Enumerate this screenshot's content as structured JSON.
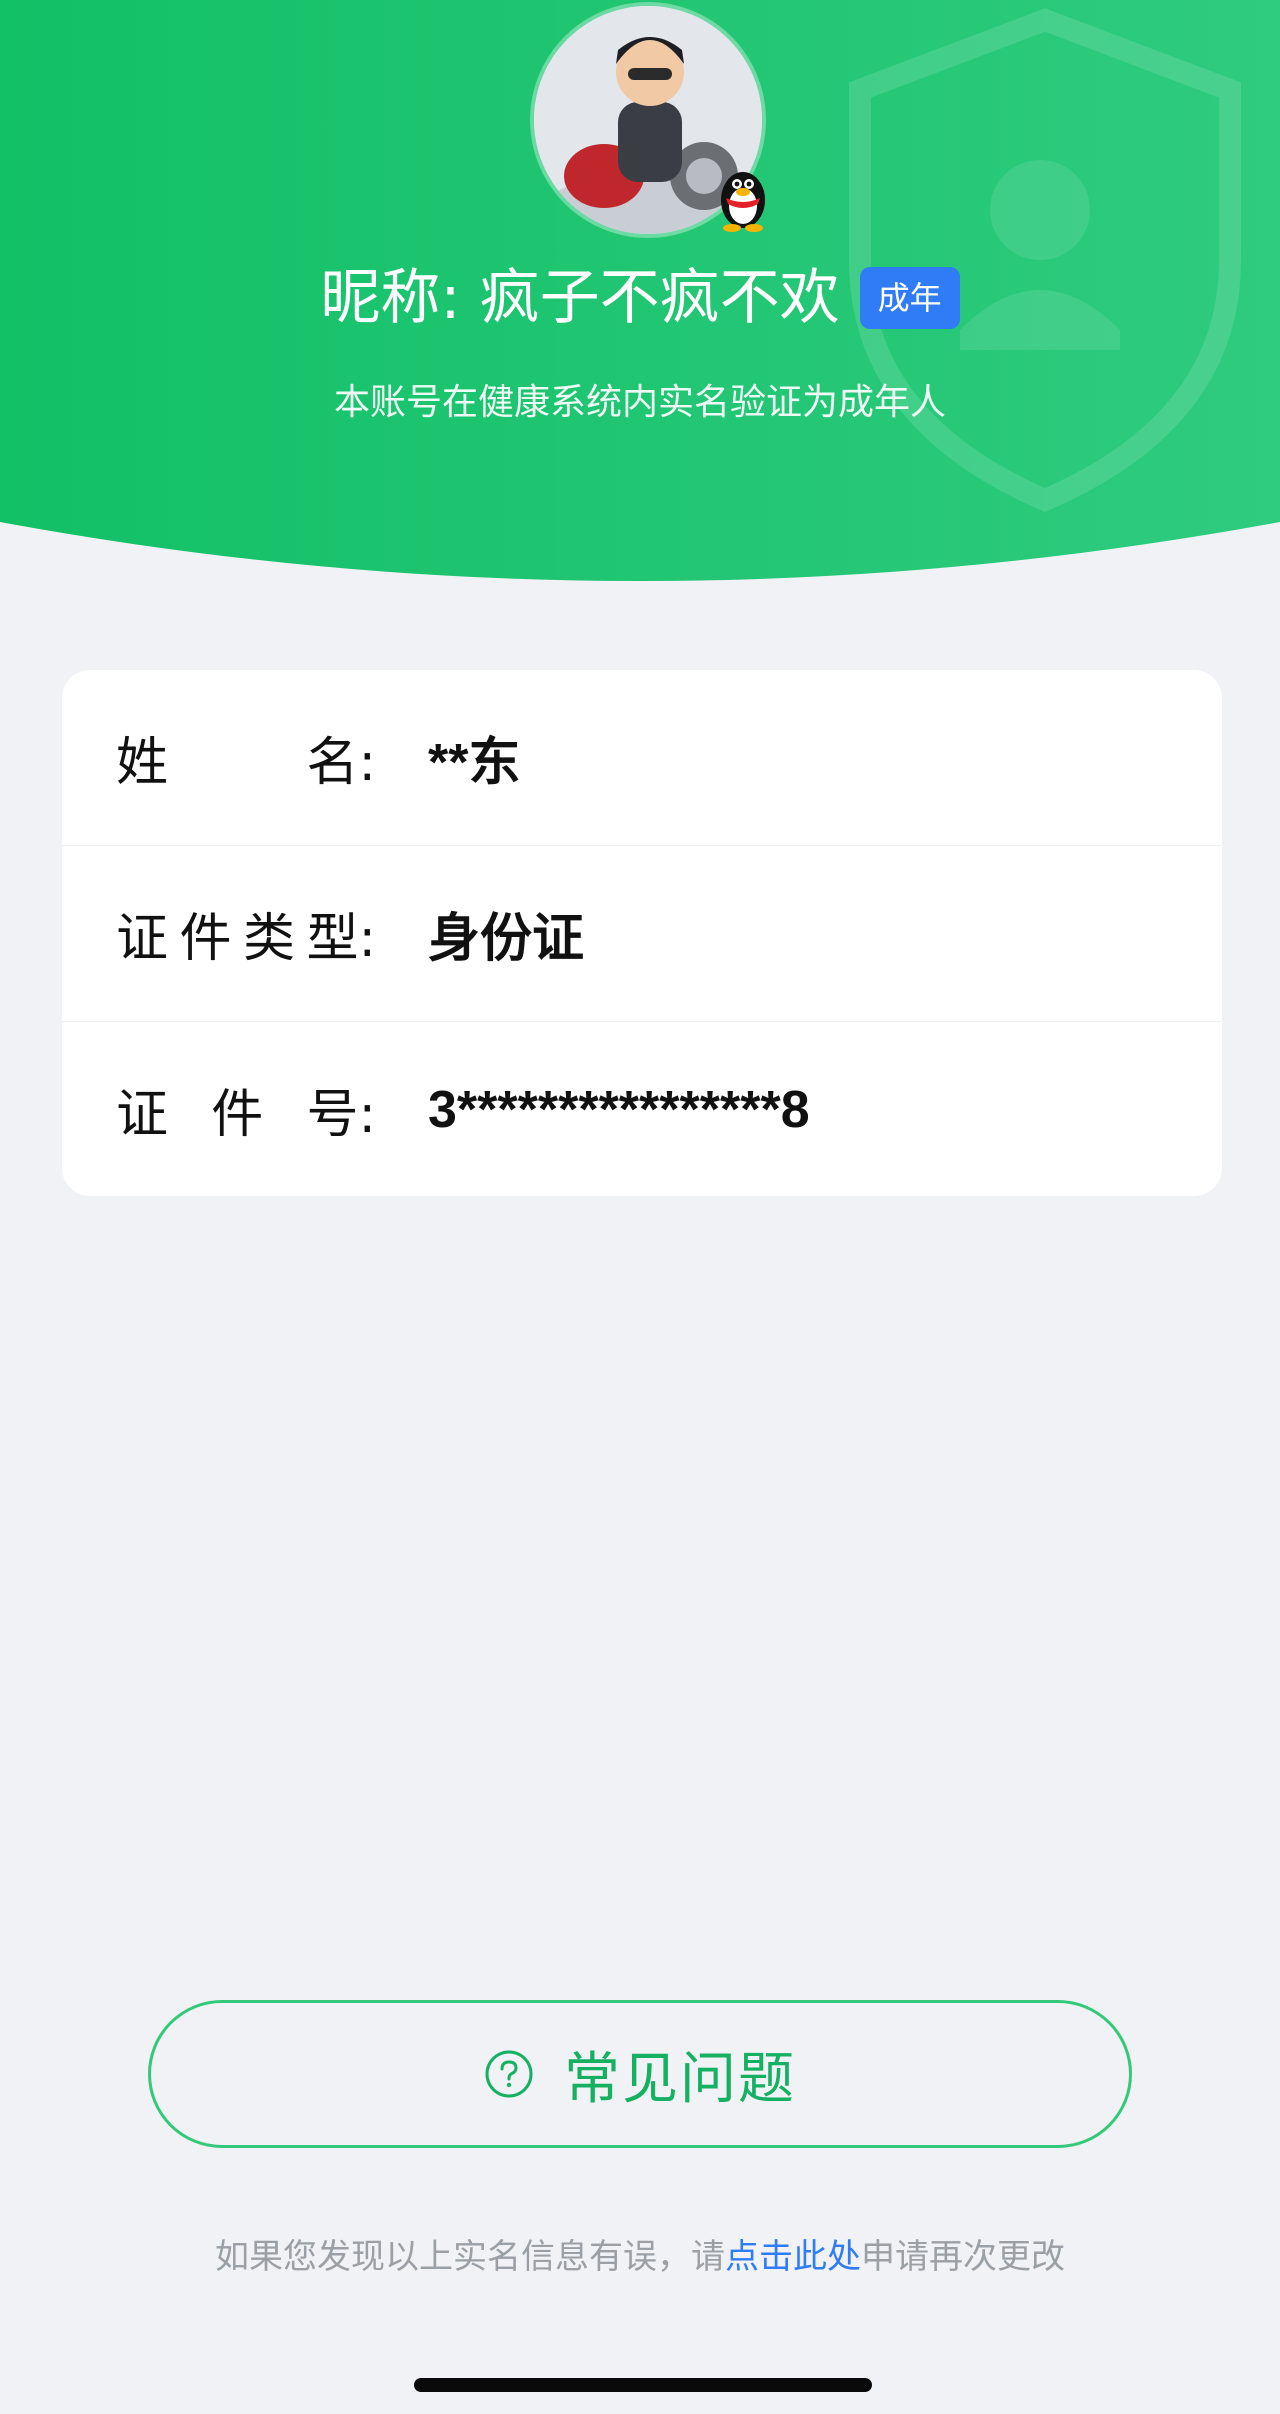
{
  "profile": {
    "nickname": "昵称: 疯子不疯不欢",
    "badge": "成年",
    "subtitle": "本账号在健康系统内实名验证为成年人"
  },
  "info_card": {
    "rows": [
      {
        "label_chars": [
          "姓",
          "名:"
        ],
        "value": "**东"
      },
      {
        "label_chars": [
          "证",
          "件",
          "类",
          "型:"
        ],
        "value": "身份证"
      },
      {
        "label_chars": [
          "证",
          "件",
          "号:"
        ],
        "value": "3****************8"
      }
    ]
  },
  "faq_button": {
    "label": "常见问题",
    "icon": "question-circle-icon"
  },
  "footer": {
    "prefix": "如果您发现以上实名信息有误，请",
    "link": "点击此处",
    "suffix": "申请再次更改"
  },
  "colors": {
    "header_green": "#1fc66f",
    "badge_blue": "#2f7cf6",
    "faq_green": "#16b063",
    "link_blue": "#2f7cf6",
    "page_bg": "#f0f2f5"
  }
}
